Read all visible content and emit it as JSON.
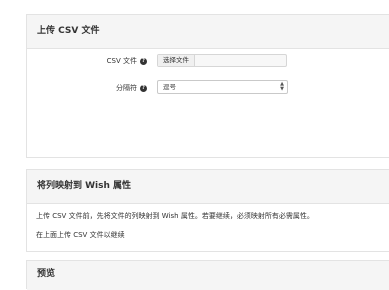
{
  "upload_panel": {
    "title": "上传 CSV 文件",
    "csv_label": "CSV 文件",
    "choose_file_button": "选择文件",
    "separator_label": "分隔符",
    "separator_value": "逗号"
  },
  "mapping_panel": {
    "title": "将列映射到 Wish 属性",
    "description": "上传 CSV 文件前，先将文件的列映射到 Wish 属性。若要继续，必须映射所有必需属性。",
    "note": "在上面上传 CSV 文件以继续"
  },
  "preview_panel": {
    "title": "预览"
  }
}
